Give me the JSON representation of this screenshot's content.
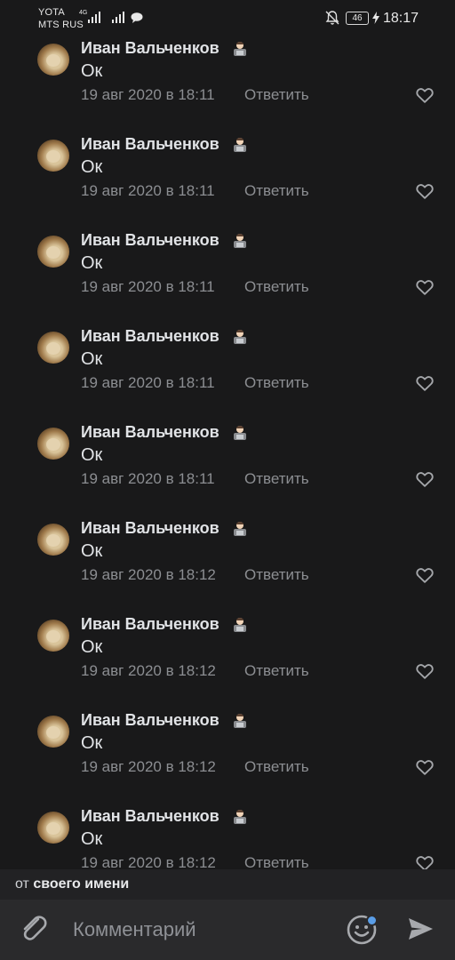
{
  "status_bar": {
    "carrier_top": "YOTA",
    "carrier_bottom": "MTS RUS",
    "network_small": "4G",
    "battery": "46",
    "time": "18:17"
  },
  "comments": [
    {
      "author": "Иван Вальченков",
      "text": "Ок",
      "date": "19 авг 2020 в 18:11",
      "reply_label": "Ответить"
    },
    {
      "author": "Иван Вальченков",
      "text": "Ок",
      "date": "19 авг 2020 в 18:11",
      "reply_label": "Ответить"
    },
    {
      "author": "Иван Вальченков",
      "text": "Ок",
      "date": "19 авг 2020 в 18:11",
      "reply_label": "Ответить"
    },
    {
      "author": "Иван Вальченков",
      "text": "Ок",
      "date": "19 авг 2020 в 18:11",
      "reply_label": "Ответить"
    },
    {
      "author": "Иван Вальченков",
      "text": "Ок",
      "date": "19 авг 2020 в 18:11",
      "reply_label": "Ответить"
    },
    {
      "author": "Иван Вальченков",
      "text": "Ок",
      "date": "19 авг 2020 в 18:12",
      "reply_label": "Ответить"
    },
    {
      "author": "Иван Вальченков",
      "text": "Ок",
      "date": "19 авг 2020 в 18:12",
      "reply_label": "Ответить"
    },
    {
      "author": "Иван Вальченков",
      "text": "Ок",
      "date": "19 авг 2020 в 18:12",
      "reply_label": "Ответить"
    },
    {
      "author": "Иван Вальченков",
      "text": "Ок",
      "date": "19 авг 2020 в 18:12",
      "reply_label": "Ответить"
    }
  ],
  "composer": {
    "from_prefix": "от",
    "from_name": "своего имени",
    "placeholder": "Комментарий"
  },
  "icons": {
    "author_badge": "technologist-emoji-icon",
    "like": "heart-outline-icon",
    "attach": "paperclip-icon",
    "emoji": "smile-icon",
    "send": "send-arrow-icon"
  },
  "colors": {
    "background": "#19191a",
    "secondary_text": "#8c8e92",
    "accent_dot": "#5a9ee8"
  }
}
